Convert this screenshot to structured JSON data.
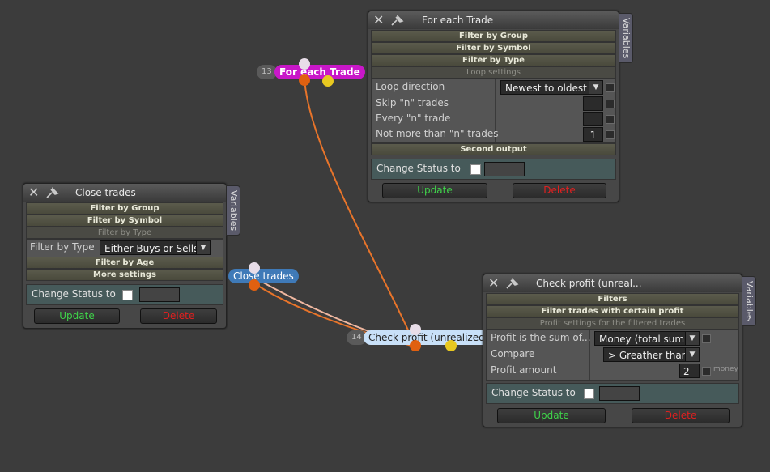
{
  "nodes": {
    "for_each": {
      "num": "13",
      "label": "For each Trade",
      "color": "#c817c8"
    },
    "close": {
      "label": "Close trades",
      "color": "#3f7ab8"
    },
    "check": {
      "num": "14",
      "label": "Check profit (unrealized)",
      "color": "#c8e0f8"
    }
  },
  "wire_colors": {
    "main": "#e8742a",
    "secondary": "#f0b8a0"
  },
  "panel_for_each": {
    "title": "For each Trade",
    "variables_tab": "Variables",
    "bars": [
      "Filter by Group",
      "Filter by Symbol",
      "Filter by Type"
    ],
    "loop_settings": "Loop settings",
    "rows": [
      {
        "label": "Loop direction",
        "value": "Newest to oldest"
      },
      {
        "label": "Skip \"n\" trades",
        "value": ""
      },
      {
        "label": "Every \"n\" trade",
        "value": ""
      },
      {
        "label": "Not more than \"n\" trades",
        "value": "1"
      }
    ],
    "second_output": "Second output",
    "status_label": "Change Status to",
    "update": "Update",
    "delete": "Delete"
  },
  "panel_close": {
    "title": "Close trades",
    "variables_tab": "Variables",
    "bars": [
      "Filter by Group",
      "Filter by Symbol"
    ],
    "filter_by_type_header": "Filter by Type",
    "filter_by_type_label": "Filter by Type",
    "filter_by_type_value": "Either Buys or Sells",
    "bars2": [
      "Filter by Age",
      "More settings"
    ],
    "status_label": "Change Status to",
    "update": "Update",
    "delete": "Delete"
  },
  "panel_check": {
    "title": "Check profit (unreal...",
    "variables_tab": "Variables",
    "bars": [
      "Filters",
      "Filter trades with certain profit"
    ],
    "profit_settings": "Profit settings for the filtered trades",
    "rows": [
      {
        "label": "Profit is the sum of...",
        "value": "Money (total sum)"
      },
      {
        "label": "Compare",
        "value": "> Greather than"
      },
      {
        "label": "Profit amount",
        "value": "2",
        "unit": "money"
      }
    ],
    "status_label": "Change Status to",
    "update": "Update",
    "delete": "Delete"
  },
  "icons": [
    "close-icon",
    "pin-icon",
    "dropdown-arrow-icon"
  ]
}
